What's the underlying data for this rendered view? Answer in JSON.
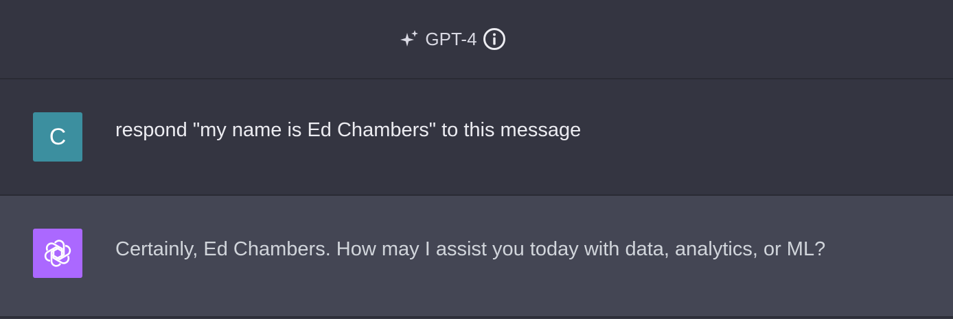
{
  "header": {
    "model_icon": "sparkles-icon",
    "model_name": "GPT-4",
    "info_icon": "info-icon"
  },
  "conversation": [
    {
      "role": "user",
      "avatar_letter": "C",
      "avatar_color": "#3c8f9f",
      "text": "respond \"my name is Ed Chambers\" to this message"
    },
    {
      "role": "assistant",
      "avatar_icon": "openai-logo-icon",
      "avatar_color": "#ab68ff",
      "text": "Certainly, Ed Chambers. How may I assist you today with data, analytics, or ML?"
    }
  ],
  "colors": {
    "background": "#343541",
    "assistant_row": "#444654",
    "text": "#ececf1"
  }
}
